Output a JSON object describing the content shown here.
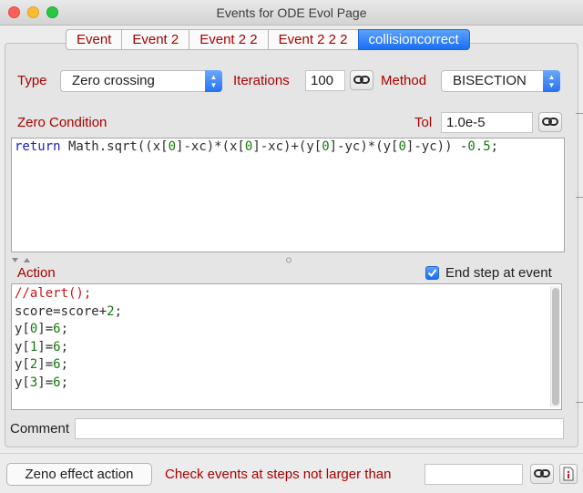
{
  "window": {
    "title": "Events for ODE Evol Page"
  },
  "tabs": [
    {
      "label": "Event",
      "active": false
    },
    {
      "label": "Event 2",
      "active": false
    },
    {
      "label": "Event 2 2",
      "active": false
    },
    {
      "label": "Event 2 2 2",
      "active": false
    },
    {
      "label": "collisioncorrect",
      "active": true
    }
  ],
  "event": {
    "type_label": "Type",
    "type_value": "Zero crossing",
    "iterations_label": "Iterations",
    "iterations_value": "100",
    "method_label": "Method",
    "method_value": "BISECTION",
    "zero_condition_label": "Zero Condition",
    "tol_label": "Tol",
    "tol_value": "1.0e-5"
  },
  "zero_code": {
    "keyword": "return",
    "parts": [
      " Math.sqrt((x[",
      "0",
      "]-xc)*(x[",
      "0",
      "]-xc)+(y[",
      "0",
      "]-yc)*(y[",
      "0",
      "]-yc)) -",
      "0.5",
      ";"
    ]
  },
  "action": {
    "label": "Action",
    "end_step_label": "End step at event",
    "end_step_checked": true,
    "lines": [
      {
        "text": "//alert();",
        "kind": "comment"
      },
      {
        "before": "score=score+",
        "num": "2",
        "after": ";"
      },
      {
        "before": "y[",
        "num": "0",
        "mid": "]=",
        "num2": "6",
        "after": ";"
      },
      {
        "before": "y[",
        "num": "1",
        "mid": "]=",
        "num2": "6",
        "after": ";"
      },
      {
        "before": "y[",
        "num": "2",
        "mid": "]=",
        "num2": "6",
        "after": ";"
      },
      {
        "before": "y[",
        "num": "3",
        "mid": "]=",
        "num2": "6",
        "after": ";"
      }
    ]
  },
  "comment": {
    "label": "Comment",
    "value": ""
  },
  "footer": {
    "zeno_button": "Zeno effect action",
    "check_label": "Check events at steps not larger than",
    "step_value": ""
  },
  "colors": {
    "accent": "#1a6ef5",
    "label_red": "#a80000",
    "keyword_blue": "#1d1dbf",
    "number_green": "#117a0e",
    "comment_red": "#c71414"
  },
  "icons": [
    "link-icon",
    "info-icon",
    "chevron-updown-icon",
    "checkmark-icon"
  ]
}
